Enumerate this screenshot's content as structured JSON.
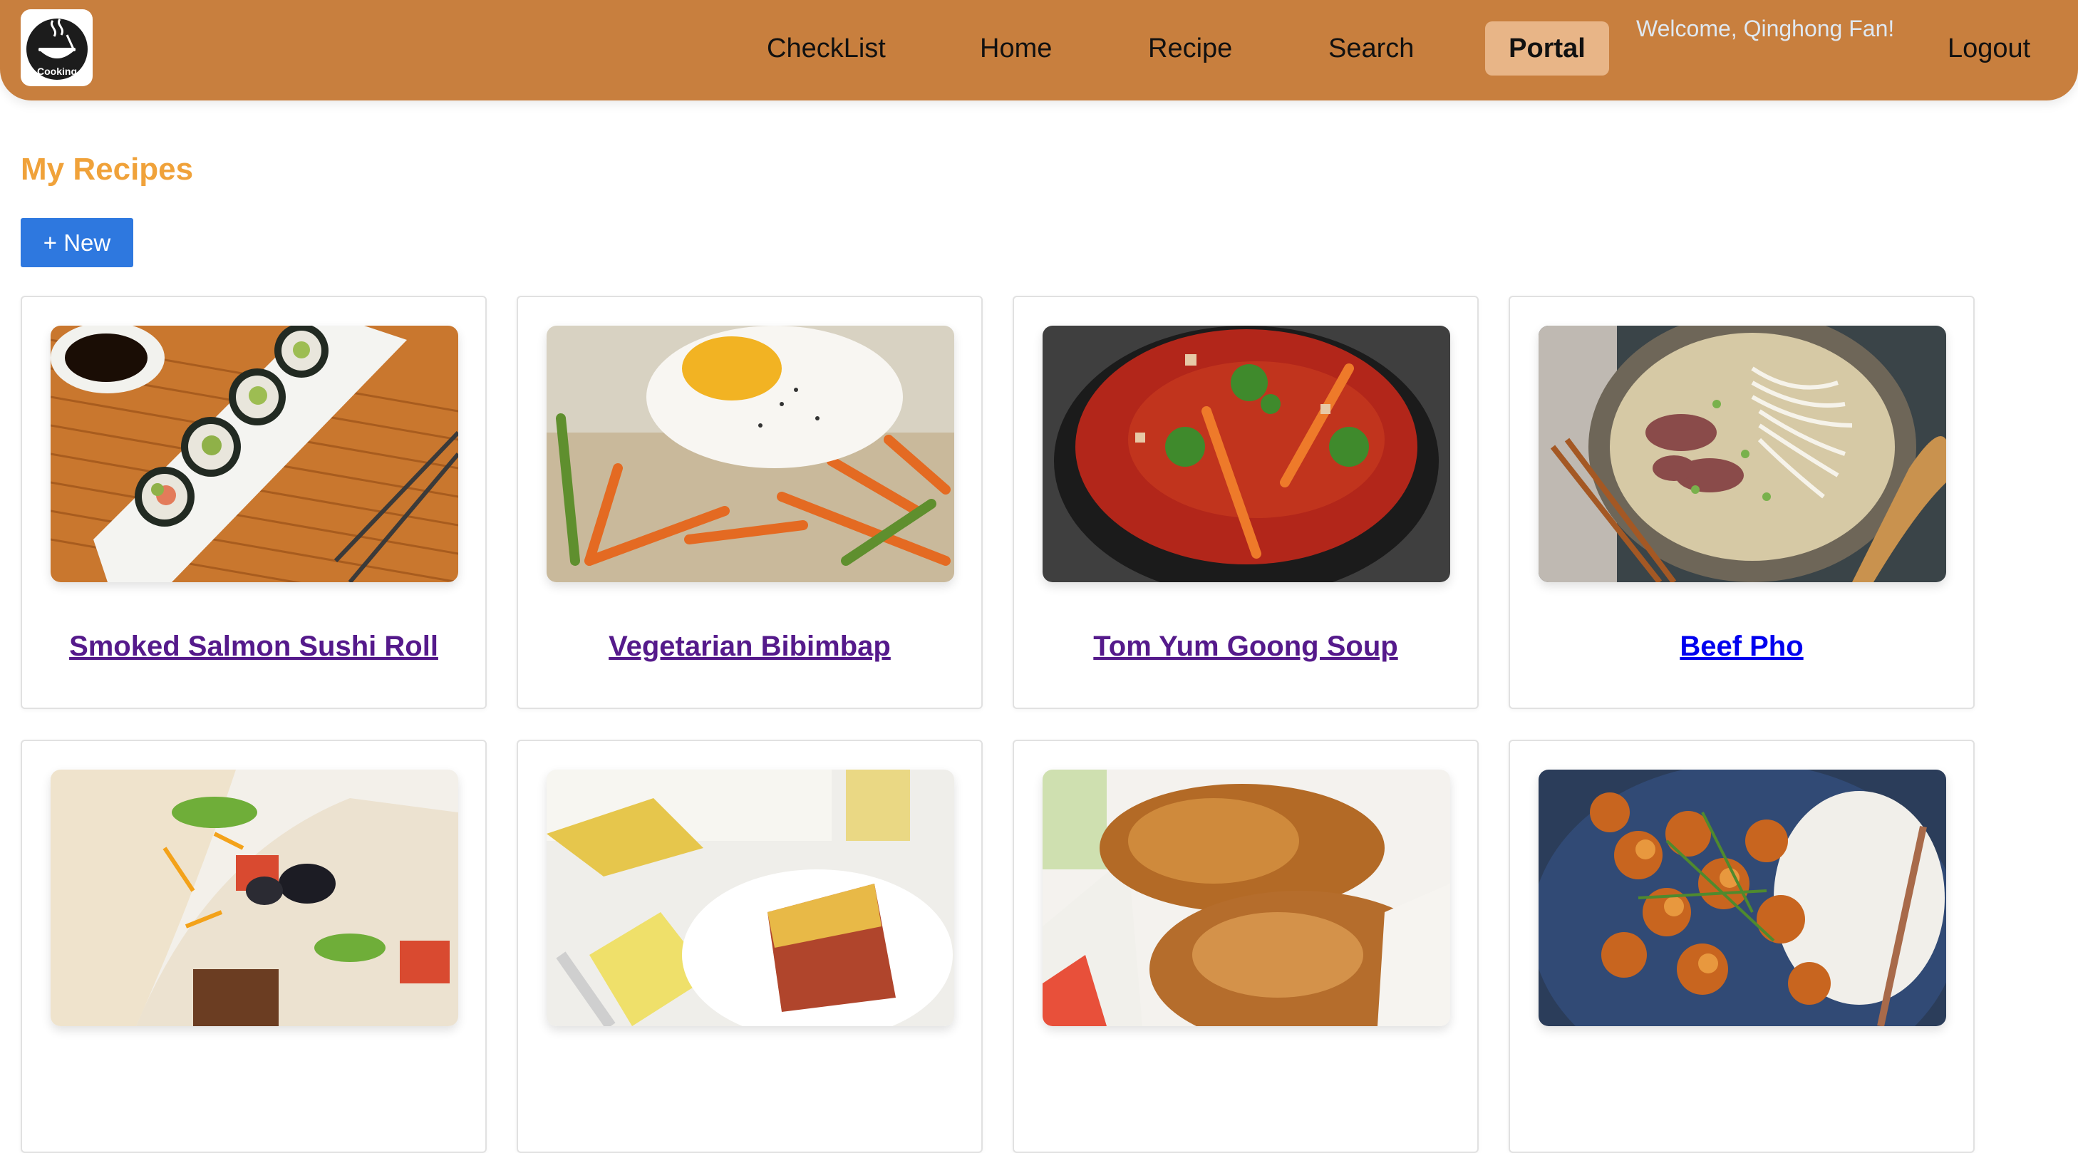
{
  "header": {
    "logo_text": "Cooking",
    "nav": [
      {
        "label": "CheckList"
      },
      {
        "label": "Home"
      },
      {
        "label": "Recipe"
      },
      {
        "label": "Search"
      },
      {
        "label": "Portal",
        "active": true
      }
    ],
    "welcome": "Welcome, Qinghong Fan!",
    "logout": "Logout"
  },
  "main": {
    "title": "My Recipes",
    "new_button": "+ New",
    "recipes": [
      {
        "title": "Smoked Salmon Sushi Roll",
        "image": "sushi-roll-photo"
      },
      {
        "title": "Vegetarian Bibimbap",
        "image": "bibimbap-photo"
      },
      {
        "title": "Tom Yum Goong Soup",
        "image": "tom-yum-soup-photo"
      },
      {
        "title": "Beef Pho",
        "image": "beef-pho-photo"
      },
      {
        "title": "",
        "image": "taco-photo"
      },
      {
        "title": "",
        "image": "lasagna-photo"
      },
      {
        "title": "",
        "image": "fried-fish-photo"
      },
      {
        "title": "",
        "image": "chicken-curry-rice-photo"
      }
    ]
  },
  "colors": {
    "header_bg": "#c87f3e",
    "active_tab_bg": "#e8b587",
    "title_orange": "#f0a23a",
    "new_button_blue": "#2e78df",
    "visited_link": "#551a8b",
    "unvisited_link": "#0000ee"
  }
}
